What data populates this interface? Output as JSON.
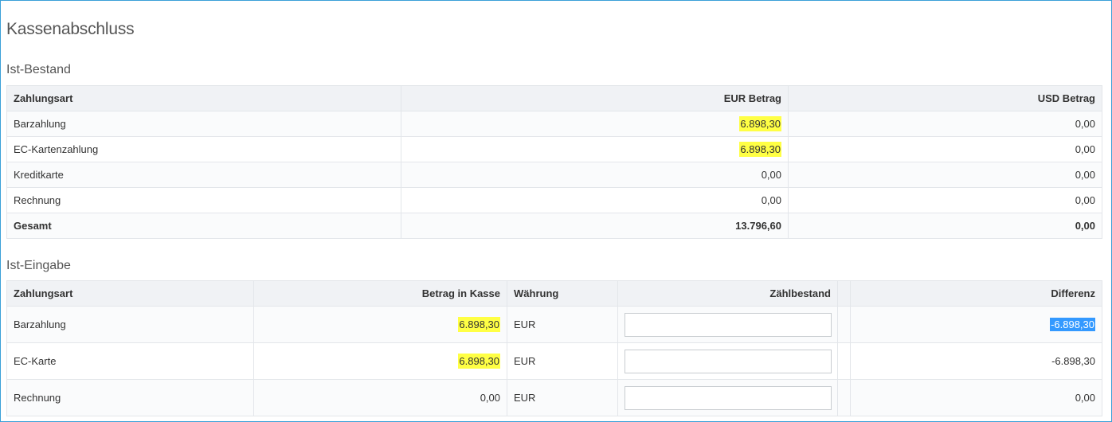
{
  "page": {
    "title": "Kassenabschluss"
  },
  "ist_bestand": {
    "title": "Ist-Bestand",
    "headers": {
      "payment_type": "Zahlungsart",
      "eur": "EUR Betrag",
      "usd": "USD Betrag"
    },
    "rows": [
      {
        "label": "Barzahlung",
        "eur": "6.898,30",
        "usd": "0,00"
      },
      {
        "label": "EC-Kartenzahlung",
        "eur": "6.898,30",
        "usd": "0,00"
      },
      {
        "label": "Kreditkarte",
        "eur": "0,00",
        "usd": "0,00"
      },
      {
        "label": "Rechnung",
        "eur": "0,00",
        "usd": "0,00"
      }
    ],
    "total": {
      "label": "Gesamt",
      "eur": "13.796,60",
      "usd": "0,00"
    }
  },
  "ist_eingabe": {
    "title": "Ist-Eingabe",
    "headers": {
      "payment_type": "Zahlungsart",
      "amount": "Betrag in Kasse",
      "currency": "Währung",
      "count": "Zählbestand",
      "difference": "Differenz"
    },
    "rows": [
      {
        "label": "Barzahlung",
        "amount": "6.898,30",
        "currency": "EUR",
        "count_value": "",
        "difference": "-6.898,30"
      },
      {
        "label": "EC-Karte",
        "amount": "6.898,30",
        "currency": "EUR",
        "count_value": "",
        "difference": "-6.898,30"
      },
      {
        "label": "Rechnung",
        "amount": "0,00",
        "currency": "EUR",
        "count_value": "",
        "difference": "0,00"
      }
    ]
  },
  "colors": {
    "highlight": "#ffff44",
    "selection": "#3399ff",
    "frame": "#3aa0d8",
    "header_bg": "#f0f2f5"
  }
}
